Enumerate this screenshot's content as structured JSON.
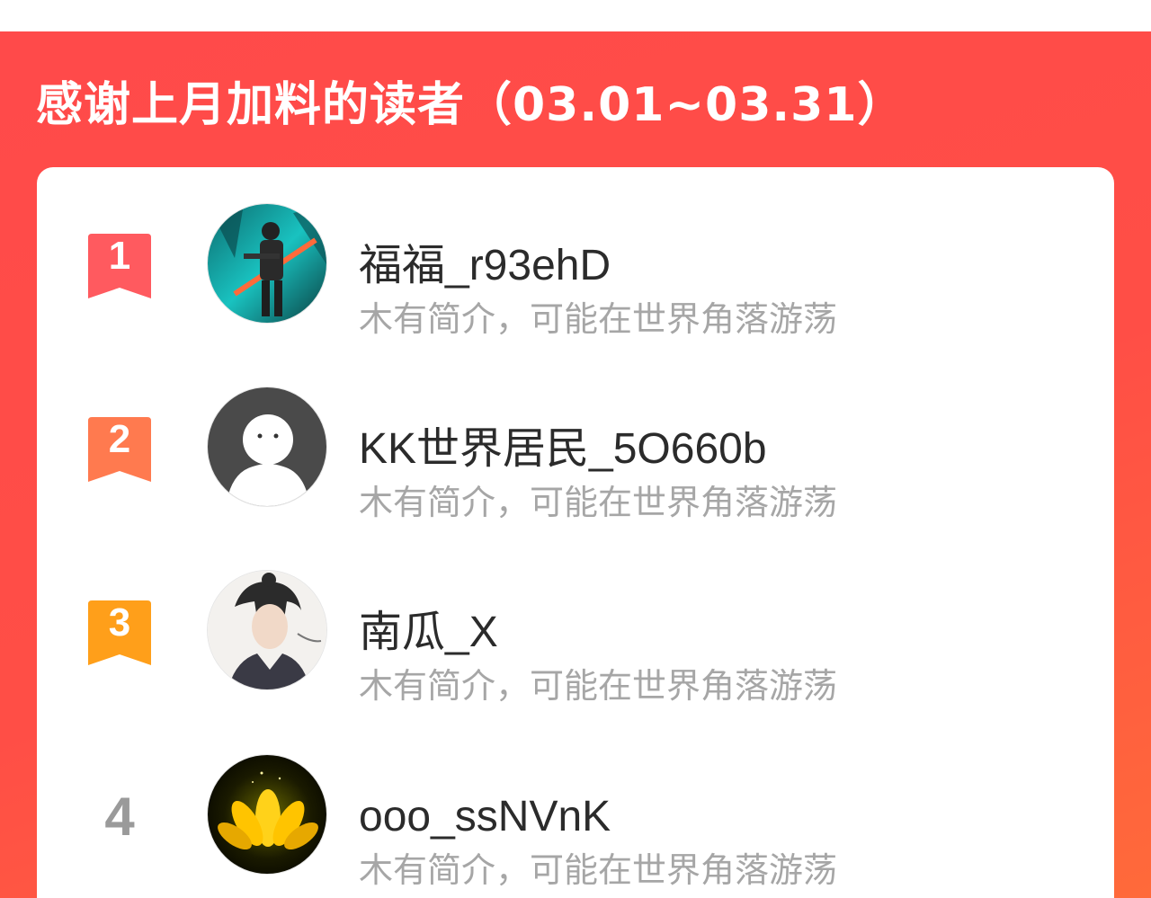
{
  "header": {
    "title": "感谢上月加料的读者（03.01~03.31）"
  },
  "colors": {
    "panel_bg": "#ff4a4a",
    "rank1": "#ff5a5f",
    "rank2": "#ff7a4f",
    "rank3": "#ff9f1a",
    "rank_plain": "#9a9a9a"
  },
  "readers": [
    {
      "rank": "1",
      "name": "福福_r93ehD",
      "bio": "木有简介，可能在世界角落游荡",
      "avatar": "game-soldier-avatar"
    },
    {
      "rank": "2",
      "name": "KK世界居民_5O660b",
      "bio": "木有简介，可能在世界角落游荡",
      "avatar": "default-ghost-avatar"
    },
    {
      "rank": "3",
      "name": "南瓜_X",
      "bio": "木有简介，可能在世界角落游荡",
      "avatar": "ink-portrait-avatar"
    },
    {
      "rank": "4",
      "name": "ooo_ssNVnK",
      "bio": "木有简介，可能在世界角落游荡",
      "avatar": "golden-lotus-avatar"
    }
  ]
}
